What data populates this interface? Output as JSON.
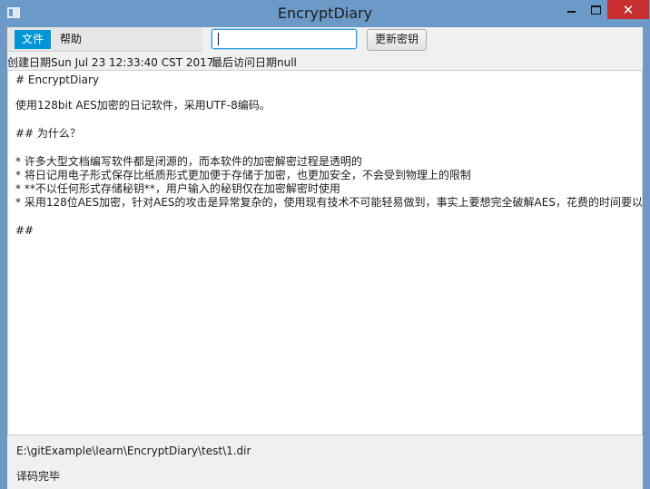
{
  "window": {
    "title": "EncryptDiary",
    "close": "✕"
  },
  "menu": {
    "file": "文件",
    "help": "帮助"
  },
  "toolbar": {
    "password_value": "",
    "update_button": "更新密钥"
  },
  "info": {
    "created": "创建日期Sun Jul 23 12:33:40 CST 2017",
    "last_visit": "最后访问日期null"
  },
  "editor": {
    "lines": [
      "# EncryptDiary",
      "",
      "使用128bit AES加密的日记软件，采用UTF-8编码。",
      "",
      "## 为什么？",
      "",
      "* 许多大型文档编写软件都是闭源的，而本软件的加密解密过程是透明的",
      "* 将日记用电子形式保存比纸质形式更加便于存储于加密，也更加安全，不会受到物理上的限制",
      "* **不以任何形式存储秘钥**，用户输入的秘钥仅在加密解密时使用",
      "* 采用128位AES加密，针对AES的攻击是异常复杂的，使用现有技术不可能轻易做到，事实上要想完全破解AES，花费的时间要以数",
      "",
      "##"
    ]
  },
  "status": {
    "path": "E:\\gitExample\\learn\\EncryptDiary\\test\\1.dir",
    "message": "译码完毕"
  }
}
